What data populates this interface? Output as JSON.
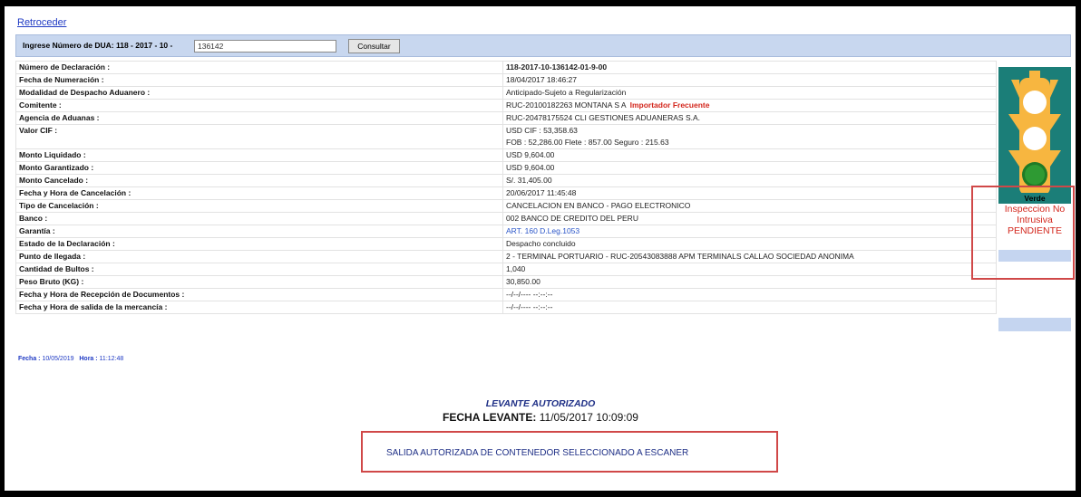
{
  "back_link": "Retroceder",
  "search": {
    "label": "Ingrese Número de DUA: 118 - 2017 - 10 -",
    "value": "136142",
    "button": "Consultar"
  },
  "declaration_rows": [
    {
      "label": "Número de Declaración :",
      "value": "118-2017-10-136142-01-9-00",
      "value_bold": true
    },
    {
      "label": "Fecha de Numeración :",
      "value": "18/04/2017 18:46:27"
    },
    {
      "label": "Modalidad de Despacho Aduanero :",
      "value": "Anticipado-Sujeto a Regularización"
    },
    {
      "label": "Comitente :",
      "value": "RUC-20100182263 MONTANA S A",
      "tag": "Importador Frecuente"
    },
    {
      "label": "Agencia de Aduanas :",
      "value": "RUC-20478175524 CLI GESTIONES ADUANERAS S.A."
    },
    {
      "label": "Valor CIF :",
      "value": "USD CIF  : 53,358.63",
      "value2": "FOB  : 52,286.00  Flete  : 857.00  Seguro  : 215.63"
    },
    {
      "label": "Monto Liquidado :",
      "value": "USD 9,604.00"
    },
    {
      "label": "Monto Garantizado :",
      "value": "USD 9,604.00"
    },
    {
      "label": "Monto Cancelado :",
      "value": "S/. 31,405.00"
    },
    {
      "label": "Fecha y Hora de Cancelación :",
      "value": "20/06/2017 11:45:48"
    },
    {
      "label": "Tipo de Cancelación :",
      "value": "CANCELACION EN BANCO - PAGO ELECTRONICO"
    },
    {
      "label": "Banco :",
      "value": "002 BANCO DE CREDITO DEL PERU"
    },
    {
      "label": "Garantía :",
      "value": "ART. 160 D.Leg.1053",
      "link": true
    },
    {
      "label": "Estado de la Declaración :",
      "value": "Despacho concluido"
    },
    {
      "label": "Punto de llegada :",
      "value": "2 - TERMINAL PORTUARIO - RUC-20543083888 APM TERMINALS CALLAO SOCIEDAD ANONIMA"
    },
    {
      "label": "Cantidad de Bultos :",
      "value": "1,040"
    },
    {
      "label": "Peso Bruto (KG) :",
      "value": "30,850.00"
    },
    {
      "label": "Fecha y Hora de Recepción de Documentos :",
      "value": "--/--/---- --:--:--"
    },
    {
      "label": "Fecha y Hora de salida de la mercancía :",
      "value": "--/--/---- --:--:--"
    }
  ],
  "semaphore": {
    "color_label": "Verde",
    "lit_color": "green",
    "status_lines": [
      "Inspeccion No",
      "Intrusiva",
      "PENDIENTE"
    ]
  },
  "fecha_hora": {
    "fecha_label": "Fecha :",
    "fecha_value": "10/05/2019",
    "hora_label": "Hora :",
    "hora_value": "11:12:48"
  },
  "levante": {
    "title": "LEVANTE AUTORIZADO",
    "date_label": "FECHA LEVANTE:",
    "date_value": "11/05/2017 10:09:09"
  },
  "salida_message": "SALIDA AUTORIZADA DE CONTENEDOR SELECCIONADO A ESCANER",
  "colors": {
    "link": "#1f3ac4",
    "alert_red": "#d3261c",
    "header_bar": "#c8d7ef",
    "semaphore_bg": "#1b7e78"
  }
}
